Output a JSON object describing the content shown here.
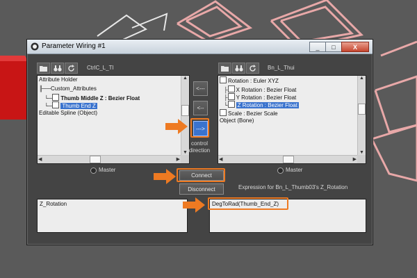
{
  "window": {
    "title": "Parameter Wiring #1",
    "minimize_glyph": "_",
    "maximize_glyph": "□",
    "close_glyph": "X"
  },
  "left_panel": {
    "header": "CtrlC_L_Tl",
    "toolbar_icons": [
      "folder-icon",
      "binoculars-icon",
      "refresh-icon"
    ],
    "tree": [
      {
        "text": "Attribute Holder",
        "bold": false,
        "selected": false,
        "icon": false
      },
      {
        "text": "Custom_Attributes",
        "bold": false,
        "selected": false,
        "icon": false
      },
      {
        "text": "Thumb Middle Z : Bezier Float",
        "bold": true,
        "selected": false,
        "icon": true
      },
      {
        "text": "Thumb End Z",
        "bold": false,
        "selected": true,
        "icon": true
      },
      {
        "text": "Editable Spline (Object)",
        "bold": false,
        "selected": false,
        "icon": false
      }
    ],
    "master_label": "Master"
  },
  "right_panel": {
    "header": "Bn_L_Thui",
    "toolbar_icons": [
      "folder-icon",
      "binoculars-icon",
      "refresh-icon"
    ],
    "tree": [
      {
        "text": "Rotation : Euler XYZ",
        "bold": false,
        "selected": false,
        "icon": true
      },
      {
        "text": "X Rotation : Bezier Float",
        "bold": false,
        "selected": false,
        "icon": true
      },
      {
        "text": "Y Rotation : Bezier Float",
        "bold": false,
        "selected": false,
        "icon": true
      },
      {
        "text": "Z Rotation : Bezier Float",
        "bold": false,
        "selected": true,
        "icon": true
      },
      {
        "text": "Scale : Bezier Scale",
        "bold": false,
        "selected": false,
        "icon": true
      },
      {
        "text": "Object (Bone)",
        "bold": false,
        "selected": false,
        "icon": false
      }
    ],
    "master_label": "Master"
  },
  "direction": {
    "left_arrow": "<---",
    "bidirectional": "<--",
    "right_arrow": "--->",
    "caption": "control direction"
  },
  "actions": {
    "connect": "Connect",
    "disconnect": "Disconnect"
  },
  "expressions": {
    "right_caption": "Expression for Bn_L_Thumb03's Z_Rotation",
    "left_value": "Z_Rotation",
    "right_value": "DegToRad(Thumb_End_Z)"
  },
  "colors": {
    "highlight": "#ee7a22",
    "selection": "#3a73ce",
    "wire_pink": "#e9a6a6",
    "wire_red": "#d41414"
  }
}
